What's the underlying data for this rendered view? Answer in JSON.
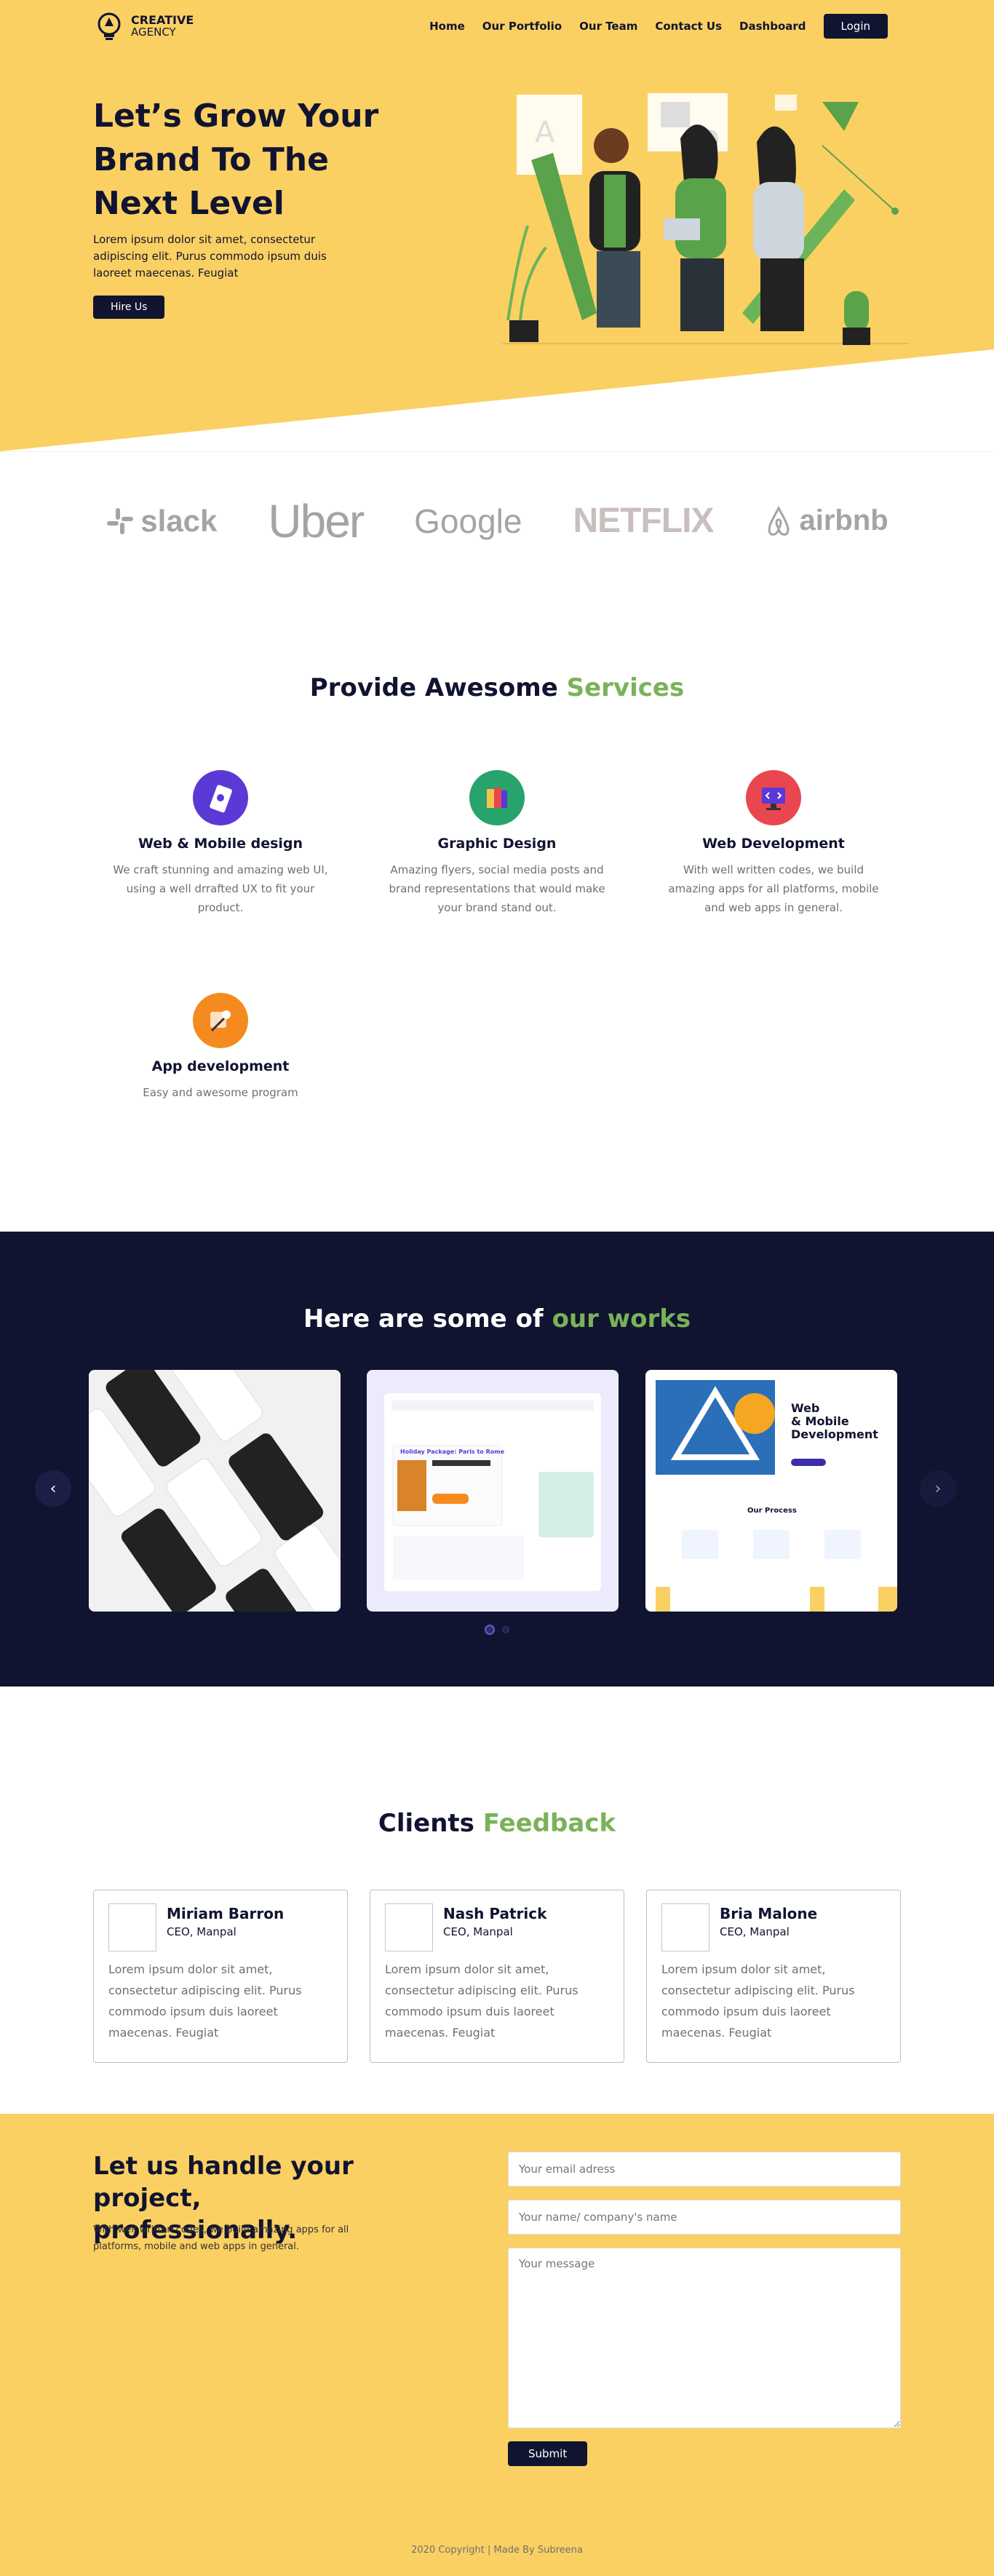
{
  "nav": {
    "brand_line1": "CREATIVE",
    "brand_line2": "AGENCY",
    "links": [
      "Home",
      "Our Portfolio",
      "Our Team",
      "Contact Us",
      "Dashboard"
    ],
    "login_label": "Login"
  },
  "hero": {
    "title": "Let’s Grow Your Brand To The Next Level",
    "subtitle": "Lorem ipsum dolor sit amet, consectetur adipiscing elit. Purus commodo ipsum duis laoreet maecenas. Feugiat",
    "button_label": "Hire Us"
  },
  "brands": [
    "slack",
    "Uber",
    "Google",
    "NETFLIX",
    "airbnb"
  ],
  "services": {
    "title_plain": "Provide Awesome ",
    "title_accent": "Services",
    "items": [
      {
        "name": "Web & Mobile design",
        "desc": "We craft stunning and amazing web UI, using a well drrafted UX to fit your product.",
        "icon_color": "#5b39d6"
      },
      {
        "name": "Graphic Design",
        "desc": "Amazing flyers, social media posts and brand representations that would make your brand stand out.",
        "icon_color": "#27a36b"
      },
      {
        "name": "Web Development",
        "desc": "With well written codes, we build amazing apps for all platforms, mobile and web apps in general.",
        "icon_color": "#e8474f"
      },
      {
        "name": "App development",
        "desc": "Easy and awesome program",
        "icon_color": "#f58a1f"
      }
    ]
  },
  "works": {
    "title_plain": "Here are some of ",
    "title_accent": "our works",
    "prev_icon": "chevron-left-icon",
    "next_icon": "chevron-right-icon",
    "card2_heading": "Holiday Package: Paris to Rome",
    "card3_heading_line1": "Web",
    "card3_heading_line2": "& Mobile",
    "card3_heading_line3": "Development",
    "card3_process": "Our Process"
  },
  "feedback": {
    "title_plain": "Clients ",
    "title_accent": "Feedback",
    "items": [
      {
        "name": "Miriam Barron",
        "role": "CEO, Manpal",
        "text": "Lorem ipsum dolor sit amet, consectetur adipiscing elit. Purus commodo ipsum duis laoreet maecenas. Feugiat"
      },
      {
        "name": "Nash Patrick",
        "role": "CEO, Manpal",
        "text": "Lorem ipsum dolor sit amet, consectetur adipiscing elit. Purus commodo ipsum duis laoreet maecenas. Feugiat"
      },
      {
        "name": "Bria Malone",
        "role": "CEO, Manpal",
        "text": "Lorem ipsum dolor sit amet, consectetur adipiscing elit. Purus commodo ipsum duis laoreet maecenas. Feugiat"
      }
    ]
  },
  "contact": {
    "title": "Let us handle your project, professionally.",
    "subtitle": "With well written codes, we build amazing apps for all platforms, mobile and web apps in general.",
    "email_placeholder": "Your email adress",
    "name_placeholder": "Your name/ company's name",
    "message_placeholder": "Your message",
    "submit_label": "Submit",
    "copyright": "2020 Copyright | Made By Subreena"
  },
  "colors": {
    "yellow": "#fbd062",
    "navy": "#111430",
    "green": "#7ab259"
  }
}
